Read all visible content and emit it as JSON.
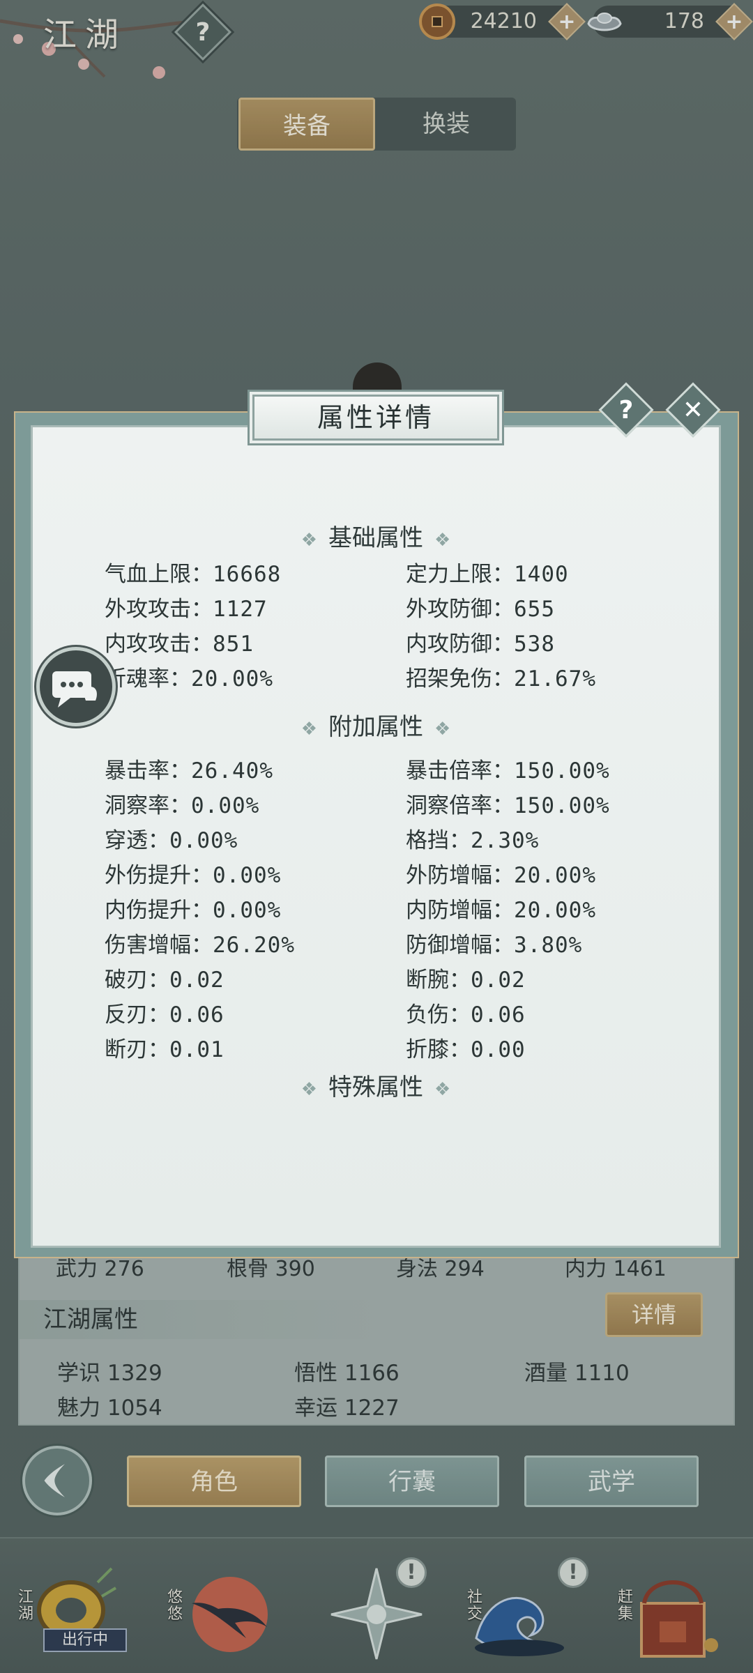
{
  "header": {
    "title": "江湖",
    "help_label": "?",
    "copper": {
      "amount": "24210",
      "icon": "copper-coin-icon",
      "add_label": "+"
    },
    "silver": {
      "amount": "178",
      "icon": "silver-ingot-icon",
      "add_label": "+"
    }
  },
  "equip_tabs": {
    "active": "装备",
    "inactive": "换装"
  },
  "modal": {
    "title": "属性详情",
    "help_label": "?",
    "close_label": "✕",
    "ornament": "❖",
    "groups": [
      {
        "title": "基础属性",
        "rows": [
          [
            {
              "label": "气血上限：",
              "value": "16668"
            },
            {
              "label": "定力上限：",
              "value": "1400"
            }
          ],
          [
            {
              "label": "外攻攻击：",
              "value": "1127"
            },
            {
              "label": "外攻防御：",
              "value": "655"
            }
          ],
          [
            {
              "label": "内攻攻击：",
              "value": "851"
            },
            {
              "label": "内攻防御：",
              "value": "538"
            }
          ],
          [
            {
              "label": "折魂率：",
              "value": "20.00%"
            },
            {
              "label": "招架免伤：",
              "value": "21.67%"
            }
          ]
        ]
      },
      {
        "title": "附加属性",
        "rows": [
          [
            {
              "label": "暴击率：",
              "value": "26.40%"
            },
            {
              "label": "暴击倍率：",
              "value": "150.00%"
            }
          ],
          [
            {
              "label": "洞察率：",
              "value": "0.00%"
            },
            {
              "label": "洞察倍率：",
              "value": "150.00%"
            }
          ],
          [
            {
              "label": "穿透：",
              "value": "0.00%"
            },
            {
              "label": "格挡：",
              "value": "2.30%"
            }
          ],
          [
            {
              "label": "外伤提升：",
              "value": "0.00%"
            },
            {
              "label": "外防增幅：",
              "value": "20.00%"
            }
          ],
          [
            {
              "label": "内伤提升：",
              "value": "0.00%"
            },
            {
              "label": "内防增幅：",
              "value": "20.00%"
            }
          ],
          [
            {
              "label": "伤害增幅：",
              "value": "26.20%"
            },
            {
              "label": "防御增幅：",
              "value": "3.80%"
            }
          ],
          [
            {
              "label": "破刃：",
              "value": "0.02"
            },
            {
              "label": "断腕：",
              "value": "0.02"
            }
          ],
          [
            {
              "label": "反刃：",
              "value": "0.06"
            },
            {
              "label": "负伤：",
              "value": "0.06"
            }
          ],
          [
            {
              "label": "断刃：",
              "value": "0.01"
            },
            {
              "label": "折膝：",
              "value": "0.00"
            }
          ]
        ]
      },
      {
        "title": "特殊属性",
        "rows": []
      }
    ]
  },
  "attributes_row": [
    {
      "label": "武力",
      "value": "276"
    },
    {
      "label": "根骨",
      "value": "390"
    },
    {
      "label": "身法",
      "value": "294"
    },
    {
      "label": "内力",
      "value": "1461"
    }
  ],
  "jianghu": {
    "title": "江湖属性",
    "detail_label": "详情",
    "items": [
      {
        "label": "学识",
        "value": "1329"
      },
      {
        "label": "悟性",
        "value": "1166"
      },
      {
        "label": "酒量",
        "value": "1110"
      },
      {
        "label": "魅力",
        "value": "1054"
      },
      {
        "label": "幸运",
        "value": "1227"
      }
    ]
  },
  "nav": {
    "back_icon": "back-arrow-icon",
    "tabs": [
      "角色",
      "行囊",
      "武学"
    ],
    "active_tab": "角色"
  },
  "dock": {
    "items": [
      {
        "label": "江湖",
        "icon": "travel-ring-icon",
        "tag": "出行中"
      },
      {
        "label": "悠悠",
        "icon": "swallow-icon"
      },
      {
        "label": "",
        "icon": "compass-star-icon",
        "badge": "!"
      },
      {
        "label": "社交",
        "icon": "wave-icon",
        "badge": "!"
      },
      {
        "label": "赶集",
        "icon": "market-basket-icon"
      }
    ]
  },
  "colors": {
    "accent_gold": "#b89a67",
    "panel_bg": "#eef2f1",
    "teal": "#7b9491",
    "background": "#5b6866"
  }
}
